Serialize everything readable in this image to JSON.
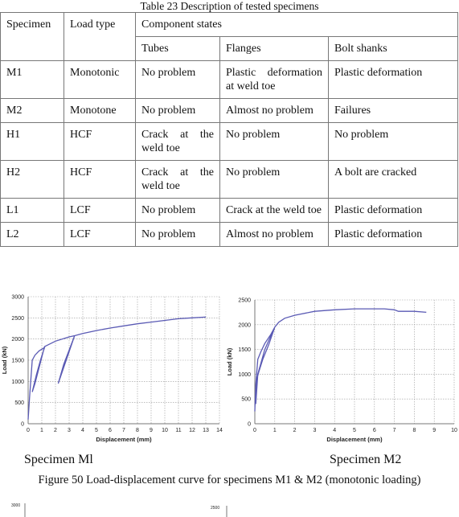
{
  "table": {
    "caption": "Table 23 Description of tested specimens",
    "headers": {
      "specimen": "Specimen",
      "load_type": "Load type",
      "component_states": "Component states",
      "tubes": "Tubes",
      "flanges": "Flanges",
      "bolt_shanks": "Bolt shanks"
    },
    "rows": [
      {
        "specimen": "M1",
        "load_type": "Monotonic",
        "tubes": "No problem",
        "flanges": "Plastic deformation at weld toe",
        "bolt_shanks": "Plastic deformation"
      },
      {
        "specimen": "M2",
        "load_type": "Monotone",
        "tubes": "No problem",
        "flanges": "Almost no problem",
        "bolt_shanks": "Failures"
      },
      {
        "specimen": "H1",
        "load_type": "HCF",
        "tubes": "Crack at the weld toe",
        "flanges": "No problem",
        "bolt_shanks": "No problem"
      },
      {
        "specimen": "H2",
        "load_type": "HCF",
        "tubes": "Crack at the weld toe",
        "flanges": "No problem",
        "bolt_shanks": "A bolt are cracked"
      },
      {
        "specimen": "L1",
        "load_type": "LCF",
        "tubes": "No problem",
        "flanges": "Crack at the weld toe",
        "bolt_shanks": "Plastic deformation"
      },
      {
        "specimen": "L2",
        "load_type": "LCF",
        "tubes": "No problem",
        "flanges": "Almost no problem",
        "bolt_shanks": "Plastic deformation"
      }
    ]
  },
  "figure": {
    "subcaption_left": "Specimen  Ml",
    "subcaption_right": "Specimen  M2",
    "caption": "Figure 50 Load-displacement curve for specimens M1 & M2 (monotonic loading)"
  },
  "chart_data": [
    {
      "type": "line",
      "title": "",
      "xlabel": "Displacement (mm)",
      "ylabel": "Load (kN)",
      "xlim": [
        0,
        14
      ],
      "ylim": [
        0,
        3000
      ],
      "xticks": [
        0,
        1,
        2,
        3,
        4,
        5,
        6,
        7,
        8,
        9,
        10,
        11,
        12,
        13,
        14
      ],
      "yticks": [
        0,
        500,
        1000,
        1500,
        2000,
        2500,
        3000
      ],
      "grid": true,
      "series": [
        {
          "name": "Specimen M1",
          "color": "#5a5ab4",
          "x": [
            0,
            0.1,
            0.3,
            0.5,
            0.8,
            1.2,
            0.9,
            0.6,
            0.3,
            0.5,
            1.2,
            2.0,
            3.0,
            3.4,
            2.2,
            2.6,
            3.4,
            4,
            5,
            6,
            7,
            8,
            9,
            10,
            11,
            12,
            13
          ],
          "y": [
            100,
            600,
            1500,
            1620,
            1720,
            1800,
            1500,
            1150,
            750,
            950,
            1820,
            1950,
            2050,
            2080,
            950,
            1400,
            2080,
            2130,
            2200,
            2260,
            2310,
            2360,
            2400,
            2440,
            2480,
            2500,
            2520
          ]
        }
      ]
    },
    {
      "type": "line",
      "title": "",
      "xlabel": "Displacement (mm)",
      "ylabel": "Load (kN)",
      "xlim": [
        0,
        10
      ],
      "ylim": [
        0,
        2500
      ],
      "xticks": [
        0,
        1,
        2,
        3,
        4,
        5,
        6,
        7,
        8,
        9,
        10
      ],
      "yticks": [
        0,
        500,
        1000,
        1500,
        2000,
        2500
      ],
      "grid": true,
      "series": [
        {
          "name": "Specimen M2",
          "color": "#5a5ab4",
          "x": [
            0,
            0.05,
            0.15,
            0.3,
            0.5,
            0.8,
            1.0,
            0.7,
            0.4,
            0.2,
            0.1,
            0.05,
            0.15,
            0.5,
            1.0,
            1.2,
            1.5,
            2,
            3,
            4,
            5,
            6,
            6.5,
            7,
            7.2,
            8,
            8.6
          ],
          "y": [
            250,
            800,
            1300,
            1450,
            1620,
            1800,
            1950,
            1600,
            1300,
            1050,
            900,
            400,
            1000,
            1500,
            1950,
            2050,
            2130,
            2190,
            2270,
            2300,
            2320,
            2320,
            2320,
            2300,
            2270,
            2270,
            2250
          ]
        }
      ]
    }
  ]
}
